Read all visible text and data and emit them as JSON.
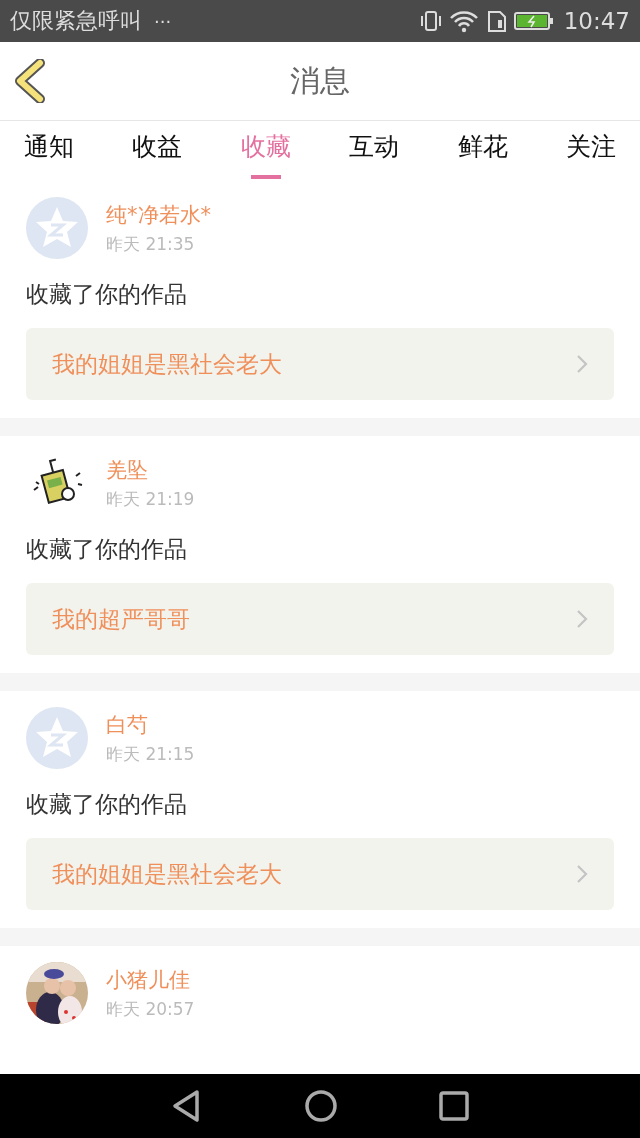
{
  "status_bar": {
    "carrier": "仅限紧急呼叫",
    "more": "···",
    "time": "10:47"
  },
  "header": {
    "title": "消息"
  },
  "tabs": [
    {
      "label": "通知",
      "selected": false
    },
    {
      "label": "收益",
      "selected": false
    },
    {
      "label": "收藏",
      "selected": true
    },
    {
      "label": "互动",
      "selected": false
    },
    {
      "label": "鲜花",
      "selected": false
    },
    {
      "label": "关注",
      "selected": false
    }
  ],
  "messages": [
    {
      "avatar": {
        "kind": "default"
      },
      "name": "纯*净若水*",
      "time": "昨天 21:35",
      "action": "收藏了你的作品",
      "work": "我的姐姐是黑社会老大"
    },
    {
      "avatar": {
        "kind": "drawing"
      },
      "name": "羌坠",
      "time": "昨天 21:19",
      "action": "收藏了你的作品",
      "work": "我的超严哥哥"
    },
    {
      "avatar": {
        "kind": "default"
      },
      "name": "白芍",
      "time": "昨天 21:15",
      "action": "收藏了你的作品",
      "work": "我的姐姐是黑社会老大"
    },
    {
      "name": "小猪儿佳",
      "time": "昨天 20:57"
    }
  ]
}
